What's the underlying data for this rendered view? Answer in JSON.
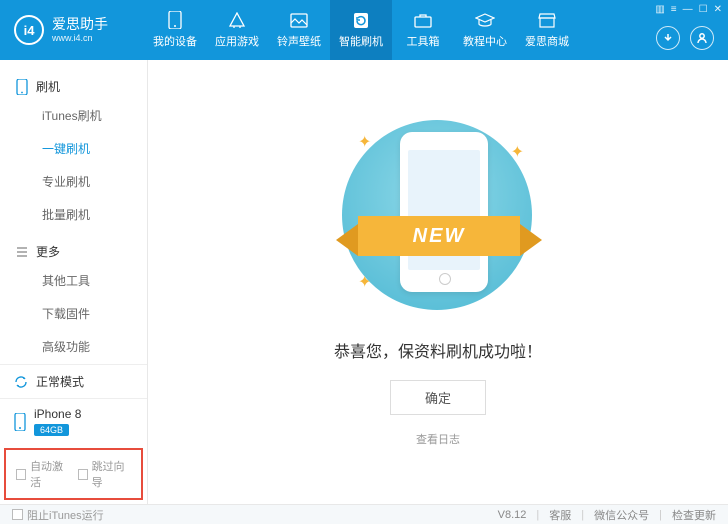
{
  "brand": {
    "name": "爱思助手",
    "url": "www.i4.cn",
    "logo_text": "i4"
  },
  "nav": [
    {
      "label": "我的设备"
    },
    {
      "label": "应用游戏"
    },
    {
      "label": "铃声壁纸"
    },
    {
      "label": "智能刷机"
    },
    {
      "label": "工具箱"
    },
    {
      "label": "教程中心"
    },
    {
      "label": "爱思商城"
    }
  ],
  "sidebar": {
    "group1": {
      "title": "刷机",
      "items": [
        "iTunes刷机",
        "一键刷机",
        "专业刷机",
        "批量刷机"
      ]
    },
    "group2": {
      "title": "更多",
      "items": [
        "其他工具",
        "下载固件",
        "高级功能"
      ]
    },
    "mode": "正常模式",
    "device": {
      "name": "iPhone 8",
      "storage": "64GB"
    },
    "checks": {
      "a": "自动激活",
      "b": "跳过向导"
    }
  },
  "main": {
    "ribbon": "NEW",
    "success": "恭喜您，保资料刷机成功啦！",
    "ok": "确定",
    "log": "查看日志"
  },
  "footer": {
    "stop_itunes": "阻止iTunes运行",
    "version": "V8.12",
    "support": "客服",
    "wechat": "微信公众号",
    "update": "检查更新"
  }
}
